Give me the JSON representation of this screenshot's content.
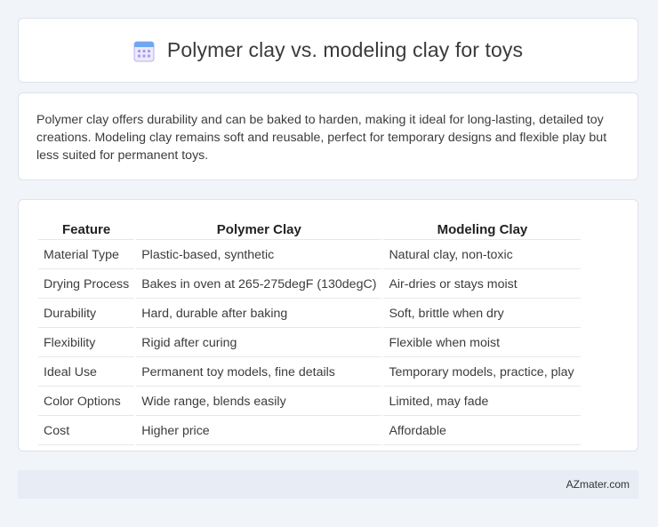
{
  "header": {
    "title": "Polymer clay vs. modeling clay for toys",
    "icon": "calendar-icon"
  },
  "summary": {
    "text": "Polymer clay offers durability and can be baked to harden, making it ideal for long-lasting, detailed toy creations. Modeling clay remains soft and reusable, perfect for temporary designs and flexible play but less suited for permanent toys."
  },
  "table": {
    "headers": [
      "Feature",
      "Polymer Clay",
      "Modeling Clay"
    ],
    "rows": [
      [
        "Material Type",
        "Plastic-based, synthetic",
        "Natural clay, non-toxic"
      ],
      [
        "Drying Process",
        "Bakes in oven at 265-275degF (130degC)",
        "Air-dries or stays moist"
      ],
      [
        "Durability",
        "Hard, durable after baking",
        "Soft, brittle when dry"
      ],
      [
        "Flexibility",
        "Rigid after curing",
        "Flexible when moist"
      ],
      [
        "Ideal Use",
        "Permanent toy models, fine details",
        "Temporary models, practice, play"
      ],
      [
        "Color Options",
        "Wide range, blends easily",
        "Limited, may fade"
      ],
      [
        "Cost",
        "Higher price",
        "Affordable"
      ]
    ]
  },
  "footer": {
    "source": "AZmater.com"
  },
  "colors": {
    "background": "#f1f4f9",
    "card": "#ffffff",
    "footer": "#e7ecf5",
    "icon_accent": "#8b7fd6"
  }
}
